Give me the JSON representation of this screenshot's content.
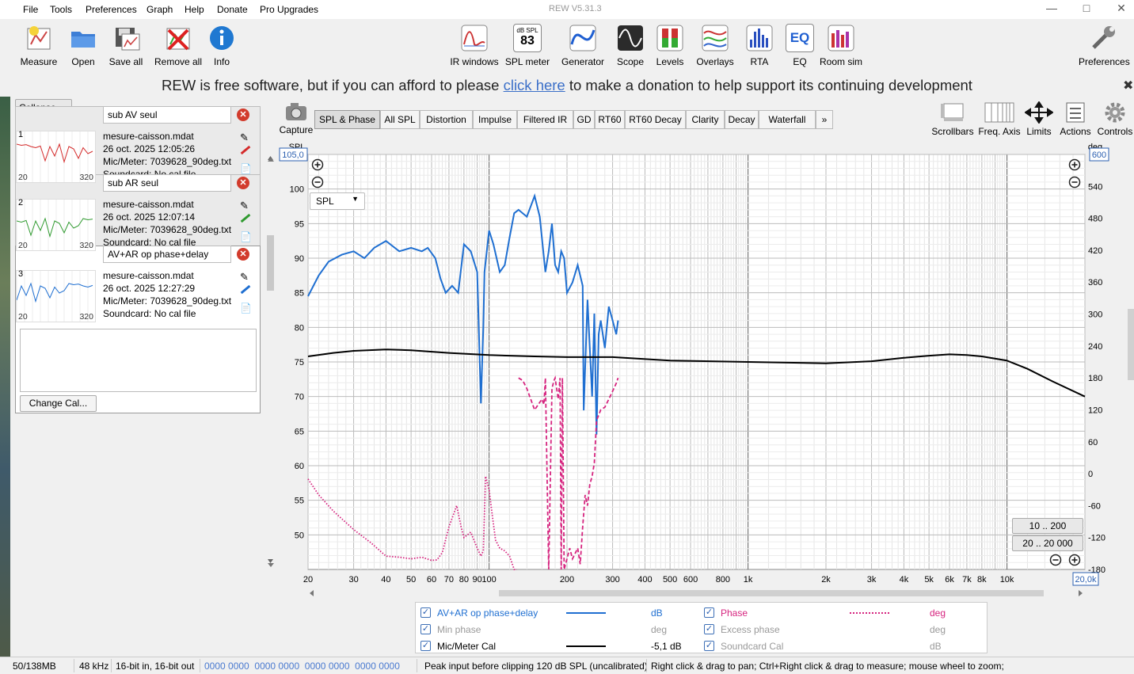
{
  "menu": {
    "file": "File",
    "tools": "Tools",
    "preferences": "Preferences",
    "graph": "Graph",
    "help": "Help",
    "donate": "Donate",
    "pro": "Pro Upgrades"
  },
  "window_title": "REW V5.31.3",
  "toolbar_left": [
    {
      "label": "Measure",
      "icon": "measure-icon"
    },
    {
      "label": "Open",
      "icon": "folder-icon"
    },
    {
      "label": "Save all",
      "icon": "save-icon"
    },
    {
      "label": "Remove all",
      "icon": "remove-icon"
    },
    {
      "label": "Info",
      "icon": "info-icon"
    }
  ],
  "toolbar_center": [
    {
      "label": "IR windows",
      "icon": "ir-windows-icon"
    },
    {
      "label": "SPL meter",
      "icon": "spl-meter-icon",
      "badge_top": "dB SPL",
      "badge_value": "83"
    },
    {
      "label": "Generator",
      "icon": "generator-icon"
    },
    {
      "label": "Scope",
      "icon": "scope-icon"
    },
    {
      "label": "Levels",
      "icon": "levels-icon"
    },
    {
      "label": "Overlays",
      "icon": "overlays-icon"
    },
    {
      "label": "RTA",
      "icon": "rta-icon"
    },
    {
      "label": "EQ",
      "icon": "eq-icon",
      "badge_value": "EQ"
    },
    {
      "label": "Room sim",
      "icon": "room-sim-icon"
    }
  ],
  "toolbar_right": {
    "label": "Preferences",
    "icon": "wrench-icon"
  },
  "donate": {
    "before": "REW is free software, but if you can afford to please ",
    "link": "click here",
    "after": " to make a donation to help support its continuing development"
  },
  "panel": {
    "collapse_label": "Collapse",
    "measurements": [
      {
        "num": "1",
        "name": "sub AV seul",
        "file": "mesure-caisson.mdat",
        "date": "26 oct. 2025 12:05:26",
        "mic": "Mic/Meter: 7039628_90deg.txt",
        "soundcard": "Soundcard: No cal file",
        "color": "#d42a2a",
        "thumb_lo": "20",
        "thumb_hi": "320"
      },
      {
        "num": "2",
        "name": "sub AR seul",
        "file": "mesure-caisson.mdat",
        "date": "26 oct. 2025 12:07:14",
        "mic": "Mic/Meter: 7039628_90deg.txt",
        "soundcard": "Soundcard: No cal file",
        "color": "#2f9a2f",
        "thumb_lo": "20",
        "thumb_hi": "320"
      },
      {
        "num": "3",
        "name": "AV+AR op phase+delay",
        "file": "mesure-caisson.mdat",
        "date": "26 oct. 2025 12:27:29",
        "mic": "Mic/Meter: 7039628_90deg.txt",
        "soundcard": "Soundcard: No cal file",
        "color": "#1f6fd1",
        "thumb_lo": "20",
        "thumb_hi": "320"
      }
    ],
    "change_cal": "Change Cal..."
  },
  "capture_label": "Capture",
  "tabs": [
    "SPL & Phase",
    "All SPL",
    "Distortion",
    "Impulse",
    "Filtered IR",
    "GD",
    "RT60",
    "RT60 Decay",
    "Clarity",
    "Decay",
    "Waterfall",
    "»"
  ],
  "right_tools": [
    {
      "label": "Scrollbars",
      "icon": "scrollbars-icon"
    },
    {
      "label": "Freq. Axis",
      "icon": "freq-axis-icon"
    },
    {
      "label": "Limits",
      "icon": "limits-icon"
    },
    {
      "label": "Actions",
      "icon": "actions-icon"
    },
    {
      "label": "Controls",
      "icon": "gear-icon"
    }
  ],
  "graph": {
    "y_left_label": "SPL",
    "y_right_label": "deg",
    "y_top_value": "105,0",
    "y_right_top_value": "600",
    "x_end_value": "20,0k",
    "spl_select": "SPL",
    "range_buttons": [
      "10 .. 200",
      "20 .. 20 000"
    ],
    "y_left_ticks": [
      "100",
      "95",
      "90",
      "85",
      "80",
      "75",
      "70",
      "65",
      "60",
      "55",
      "50"
    ],
    "y_right_ticks": [
      "540",
      "480",
      "420",
      "360",
      "300",
      "240",
      "180",
      "120",
      "60",
      "0",
      "-60",
      "-120",
      "-180"
    ],
    "x_ticks": [
      "20",
      "30",
      "40",
      "50",
      "60",
      "70",
      "80",
      "90",
      "100",
      "200",
      "300",
      "400",
      "500",
      "600",
      "800",
      "1k",
      "2k",
      "3k",
      "4k",
      "5k",
      "6k",
      "7k",
      "8k",
      "10k"
    ]
  },
  "chart_data": {
    "type": "line",
    "x_scale": "log",
    "xlim": [
      20,
      20000
    ],
    "ylim": [
      45,
      105
    ],
    "y2lim": [
      -180,
      600
    ],
    "series": [
      {
        "name": "AV+AR op phase+delay",
        "axis": "left",
        "unit": "dB",
        "color": "#1f6fd1",
        "style": "solid",
        "x": [
          20,
          22,
          24,
          27,
          30,
          33,
          36,
          40,
          45,
          50,
          55,
          58,
          62,
          65,
          68,
          72,
          76,
          80,
          85,
          90,
          93,
          95,
          96,
          100,
          104,
          110,
          115,
          120,
          125,
          130,
          140,
          150,
          157,
          165,
          170,
          175,
          180,
          185,
          190,
          195,
          200,
          210,
          220,
          230,
          232,
          240,
          250,
          255,
          260,
          265,
          270,
          280,
          290,
          300,
          310,
          315
        ],
        "y": [
          84.5,
          87.5,
          89.5,
          90.5,
          91,
          90,
          91.5,
          92.5,
          91,
          91.5,
          91,
          91.5,
          90,
          87,
          85,
          86,
          85,
          92,
          91,
          88,
          69,
          80,
          88,
          94,
          92,
          88,
          89,
          93,
          96.5,
          97,
          96,
          99,
          96,
          88,
          91,
          95,
          89,
          88,
          91,
          90,
          85,
          86.5,
          89,
          86,
          68,
          84,
          70,
          82,
          64.5,
          79,
          81,
          77,
          83,
          81,
          79,
          81
        ]
      },
      {
        "name": "Mic/Meter Cal",
        "axis": "left",
        "unit": "-5,1 dB",
        "color": "#000000",
        "style": "solid",
        "x": [
          20,
          25,
          30,
          40,
          50,
          70,
          100,
          150,
          200,
          300,
          500,
          1000,
          2000,
          3000,
          4000,
          5000,
          6000,
          7000,
          8000,
          10000,
          12000,
          15000,
          20000
        ],
        "y": [
          75.8,
          76.3,
          76.6,
          76.8,
          76.7,
          76.3,
          76.0,
          75.8,
          75.7,
          75.7,
          75.2,
          75.0,
          74.8,
          75.1,
          75.6,
          75.9,
          76.1,
          76.0,
          75.8,
          75.2,
          74.0,
          72.2,
          70.0
        ]
      },
      {
        "name": "Phase",
        "axis": "right",
        "unit": "deg",
        "color": "#d6247f",
        "style": "dotted",
        "x": [
          20,
          22,
          25,
          30,
          35,
          40,
          45,
          50,
          55,
          60,
          63,
          66,
          70,
          75,
          78,
          80,
          85,
          90,
          93,
          95,
          97,
          100,
          103,
          106,
          110,
          115,
          120,
          125,
          128
        ],
        "y": [
          -10,
          -40,
          -70,
          -105,
          -130,
          -155,
          -157,
          -160,
          -157,
          -163,
          -162,
          -148,
          -100,
          -60,
          -100,
          -120,
          -110,
          -140,
          -155,
          -145,
          -5,
          -30,
          -80,
          -125,
          -140,
          -145,
          -155,
          -180,
          -180
        ]
      },
      {
        "name": "Phase",
        "axis": "right",
        "unit": "deg",
        "color": "#d6247f",
        "style": "dashed",
        "x": [
          130,
          135,
          140,
          150,
          160,
          163,
          165,
          170,
          175,
          178,
          180,
          185,
          188,
          190,
          192,
          195,
          200,
          205,
          210,
          215,
          220,
          225,
          230,
          235,
          240,
          245,
          250,
          255,
          260,
          265,
          270,
          280,
          290,
          300,
          310,
          315
        ],
        "y": [
          180,
          175,
          160,
          120,
          140,
          130,
          180,
          -180,
          160,
          175,
          180,
          140,
          180,
          -180,
          180,
          -180,
          -160,
          -140,
          -160,
          -150,
          -140,
          -170,
          -100,
          -40,
          -60,
          -20,
          -5,
          20,
          100,
          110,
          120,
          125,
          140,
          155,
          170,
          180
        ]
      }
    ],
    "legend": [
      {
        "label": "AV+AR op phase+delay",
        "checked": true,
        "unit": "dB",
        "color": "#1f6fd1"
      },
      {
        "label": "Phase",
        "checked": true,
        "unit": "deg",
        "color": "#d6247f"
      },
      {
        "label": "Min phase",
        "checked": true,
        "unit": "deg",
        "color": "#888888",
        "disabled": true
      },
      {
        "label": "Excess phase",
        "checked": true,
        "unit": "deg",
        "color": "#888888",
        "disabled": true
      },
      {
        "label": "Mic/Meter Cal",
        "checked": true,
        "unit": "-5,1 dB",
        "color": "#000000"
      },
      {
        "label": "Soundcard Cal",
        "checked": true,
        "unit": "dB",
        "color": "#888888",
        "disabled": true
      }
    ]
  },
  "status": {
    "memory": "50/138MB",
    "rate": "48 kHz",
    "bits": "16-bit in, 16-bit out",
    "levels": "0000 0000  0000 0000  0000 0000  0000 0000",
    "peak": "Peak input before clipping 120 dB SPL (uncalibrated)",
    "hint": "Right click & drag to pan; Ctrl+Right click & drag to measure; mouse wheel to zoom;"
  }
}
